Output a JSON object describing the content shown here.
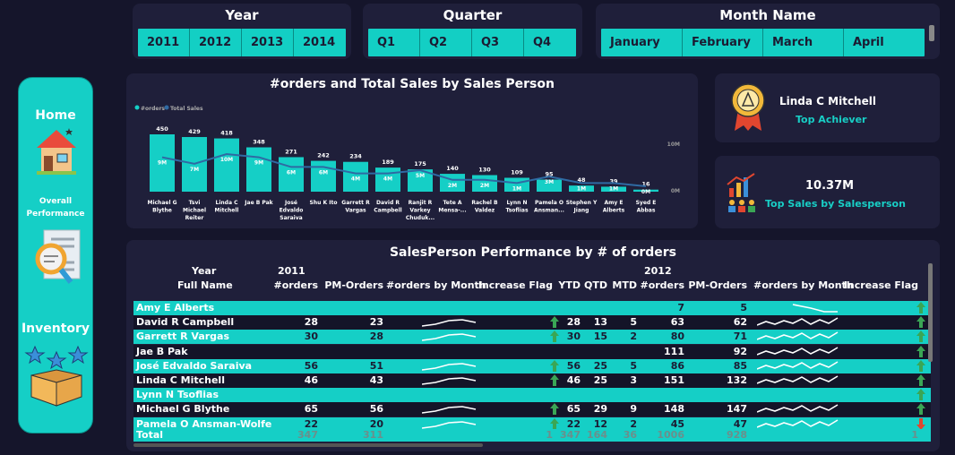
{
  "slicers": {
    "year": {
      "title": "Year",
      "options": [
        "2011",
        "2012",
        "2013",
        "2014"
      ]
    },
    "quarter": {
      "title": "Quarter",
      "options": [
        "Q1",
        "Q2",
        "Q3",
        "Q4"
      ]
    },
    "month": {
      "title": "Month Name",
      "options": [
        "January",
        "February",
        "March",
        "April"
      ]
    }
  },
  "nav": {
    "home": "Home",
    "overall": "Overall Performance",
    "inventory": "Inventory"
  },
  "top_achiever": {
    "name": "Linda C Mitchell",
    "label": "Top Achiever"
  },
  "top_sales": {
    "value": "10.37M",
    "label": "Top Sales by Salesperson"
  },
  "chart_data": {
    "type": "bar",
    "title": "#orders and Total Sales by Sales Person",
    "legend": [
      "#orders",
      "Total Sales"
    ],
    "legend_position": "top-left",
    "categories": [
      "Michael G Blythe",
      "Tsvi Michael Reiter",
      "Linda C Mitchell",
      "Jae B Pak",
      "José Edvaldo Saraiva",
      "Shu K Ito",
      "Garrett R Vargas",
      "David R Campbell",
      "Ranjit R Varkey Chuduk...",
      "Tete A Mensa-...",
      "Rachel B Valdez",
      "Lynn N Tsoflias",
      "Pamela O Ansman...",
      "Stephen Y Jiang",
      "Amy E Alberts",
      "Syed E Abbas"
    ],
    "series": [
      {
        "name": "#orders",
        "values": [
          450,
          429,
          418,
          348,
          271,
          242,
          234,
          189,
          175,
          140,
          130,
          109,
          95,
          48,
          39,
          16
        ],
        "labels": [
          "450",
          "429",
          "418",
          "348",
          "271",
          "242",
          "234",
          "189",
          "175",
          "140",
          "130",
          "109",
          "95",
          "48",
          "39",
          "16"
        ]
      },
      {
        "name": "Total Sales",
        "values": [
          9,
          7,
          10,
          9,
          6,
          6,
          4,
          4,
          5,
          2,
          2,
          1,
          3,
          1,
          1,
          0
        ],
        "labels": [
          "9M",
          "7M",
          "10M",
          "9M",
          "6M",
          "6M",
          "4M",
          "4M",
          "5M",
          "2M",
          "2M",
          "1M",
          "3M",
          "1M",
          "1M",
          "0M"
        ]
      }
    ],
    "y2_ticks": [
      "10M",
      "0M"
    ],
    "ylim": [
      0,
      450
    ]
  },
  "matrix": {
    "title": "SalesPerson Performance by # of orders",
    "row_header_top": "Year",
    "row_header": "Full Name",
    "year_2011": "2011",
    "year_2012": "2012",
    "cols_2011": [
      "#orders",
      "PM-Orders",
      "#orders by Month",
      "Increase Flag",
      "YTD",
      "QTD",
      "MTD"
    ],
    "cols_2012": [
      "#orders",
      "PM-Orders",
      "#orders by Month",
      "Increase Flag"
    ],
    "rows": [
      {
        "name": "Amy E Alberts",
        "a": "",
        "b": "",
        "spark1": false,
        "f1": "",
        "ytd": "",
        "qtd": "",
        "mtd": "",
        "c": "7",
        "d": "5",
        "spark2": "down",
        "f2": "up"
      },
      {
        "name": "David R Campbell",
        "a": "28",
        "b": "23",
        "spark1": true,
        "f1": "up",
        "ytd": "28",
        "qtd": "13",
        "mtd": "5",
        "c": "63",
        "d": "62",
        "spark2": "wave",
        "f2": "up"
      },
      {
        "name": "Garrett R Vargas",
        "a": "30",
        "b": "28",
        "spark1": true,
        "f1": "up",
        "ytd": "30",
        "qtd": "15",
        "mtd": "2",
        "c": "80",
        "d": "71",
        "spark2": "wave",
        "f2": "up"
      },
      {
        "name": "Jae B Pak",
        "a": "",
        "b": "",
        "spark1": false,
        "f1": "",
        "ytd": "",
        "qtd": "",
        "mtd": "",
        "c": "111",
        "d": "92",
        "spark2": "wave",
        "f2": "up"
      },
      {
        "name": "José Edvaldo Saraiva",
        "a": "56",
        "b": "51",
        "spark1": true,
        "f1": "up",
        "ytd": "56",
        "qtd": "25",
        "mtd": "5",
        "c": "86",
        "d": "85",
        "spark2": "wave",
        "f2": "up"
      },
      {
        "name": "Linda C Mitchell",
        "a": "46",
        "b": "43",
        "spark1": true,
        "f1": "up",
        "ytd": "46",
        "qtd": "25",
        "mtd": "3",
        "c": "151",
        "d": "132",
        "spark2": "wave",
        "f2": "up"
      },
      {
        "name": "Lynn N Tsoflias",
        "a": "",
        "b": "",
        "spark1": false,
        "f1": "",
        "ytd": "",
        "qtd": "",
        "mtd": "",
        "c": "",
        "d": "",
        "spark2": "",
        "f2": "up"
      },
      {
        "name": "Michael G Blythe",
        "a": "65",
        "b": "56",
        "spark1": true,
        "f1": "up",
        "ytd": "65",
        "qtd": "29",
        "mtd": "9",
        "c": "148",
        "d": "147",
        "spark2": "wave",
        "f2": "up"
      },
      {
        "name": "Pamela O Ansman-Wolfe",
        "a": "22",
        "b": "20",
        "spark1": true,
        "f1": "up",
        "ytd": "22",
        "qtd": "12",
        "mtd": "2",
        "c": "45",
        "d": "47",
        "spark2": "wave",
        "f2": "down"
      }
    ],
    "total": {
      "name": "Total",
      "a": "347",
      "b": "311",
      "f1": "1",
      "ytd": "347",
      "qtd": "164",
      "mtd": "36",
      "c": "1006",
      "d": "928",
      "f2": "1"
    }
  },
  "colors": {
    "teal": "#15cfc6",
    "panel": "#1f1f3a",
    "bg": "#15152b",
    "line": "#2f6aa3",
    "up": "#3aa655",
    "down": "#e0462f"
  }
}
